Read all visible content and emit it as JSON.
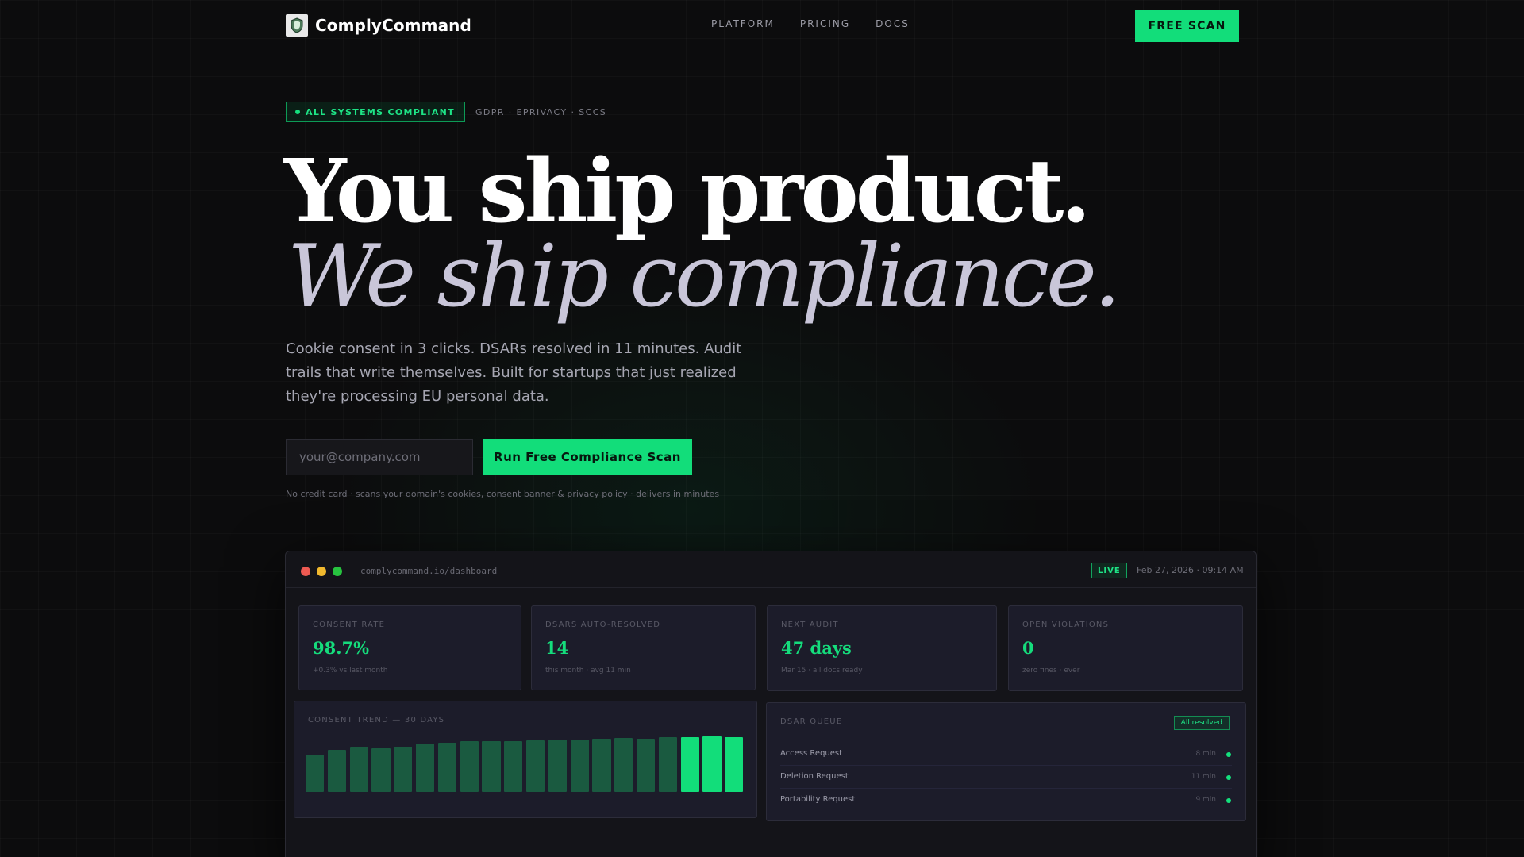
{
  "nav": {
    "brand": "ComplyCommand",
    "links": [
      "PLATFORM",
      "PRICING",
      "DOCS"
    ],
    "cta": "FREE SCAN"
  },
  "hero": {
    "badge": "ALL SYSTEMS COMPLIANT",
    "tags": "GDPR · EPRIVACY · SCCS",
    "headline_1": "You ship product.",
    "headline_2": "We ship compliance.",
    "subcopy": "Cookie consent in 3 clicks. DSARs resolved in 11 minutes. Audit trails that write themselves. Built for startups that just realized they're processing EU personal data.",
    "email_placeholder": "your@company.com",
    "cta": "Run Free Compliance Scan",
    "fineprint": "No credit card · scans your domain's cookies, consent banner & privacy policy · delivers in minutes"
  },
  "dashboard": {
    "url": "complycommand.io/dashboard",
    "live": "LIVE",
    "date": "Feb 27, 2026 · 09:14 AM",
    "stats": [
      {
        "label": "CONSENT RATE",
        "value": "98.7%",
        "sub": "+0.3% vs last month"
      },
      {
        "label": "DSARS AUTO-RESOLVED",
        "value": "14",
        "sub": "this month · avg 11 min"
      },
      {
        "label": "NEXT AUDIT",
        "value": "47 days",
        "sub": "Mar 15 · all docs ready"
      },
      {
        "label": "OPEN VIOLATIONS",
        "value": "0",
        "sub": "zero fines · ever"
      }
    ],
    "trend_title": "CONSENT TREND — 30 DAYS",
    "queue": {
      "title": "DSAR QUEUE",
      "status": "All resolved",
      "rows": [
        {
          "label": "Access Request",
          "time": "8 min"
        },
        {
          "label": "Deletion Request",
          "time": "11 min"
        },
        {
          "label": "Portability Request",
          "time": "9 min"
        }
      ]
    }
  },
  "chart_data": {
    "type": "bar",
    "title": "CONSENT TREND — 30 DAYS",
    "values": [
      0.67,
      0.76,
      0.8,
      0.78,
      0.82,
      0.87,
      0.89,
      0.91,
      0.91,
      0.92,
      0.93,
      0.94,
      0.95,
      0.96,
      0.97,
      0.96,
      0.98,
      0.99,
      1.0,
      0.99
    ],
    "highlight_from_index": 17,
    "colors": {
      "base": "#1a5a40",
      "highlight": "#12dd7a"
    }
  },
  "colors": {
    "accent": "#12dd7a",
    "background": "#0c0c0d"
  }
}
